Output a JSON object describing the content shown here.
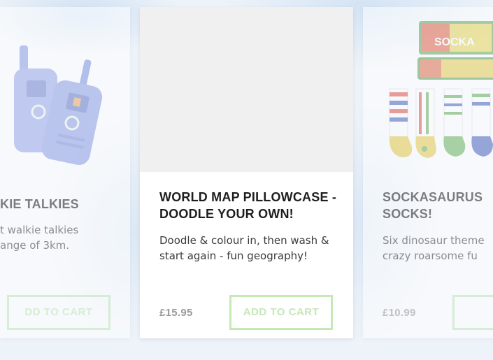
{
  "carousel": {
    "left_card": {
      "title_partial": "KIE TALKIES",
      "desc_line1": "t walkie talkies",
      "desc_line2": "ange of 3km.",
      "button_partial": "DD TO CART",
      "image_icon": "walkie-talkie-icon"
    },
    "center_card": {
      "title_line1": "WORLD MAP PILLOWCASE -",
      "title_line2": "DOODLE YOUR OWN!",
      "desc_line1": "Doodle & colour in, then wash &",
      "desc_line2": "start again - fun geography!",
      "price": "£15.95",
      "button": "ADD TO CART"
    },
    "right_card": {
      "title_line1": "SOCKASAURUS",
      "title_line2": "SOCKS!",
      "desc_line1": "Six dinosaur theme",
      "desc_line2": "crazy roarsome fu",
      "price": "£10.99",
      "box_label": "SOCKA",
      "image_icon": "socks-icon"
    }
  },
  "colors": {
    "button_border": "#c5e8b7",
    "price": "#9a9a9a",
    "title": "#1e1e1e"
  }
}
